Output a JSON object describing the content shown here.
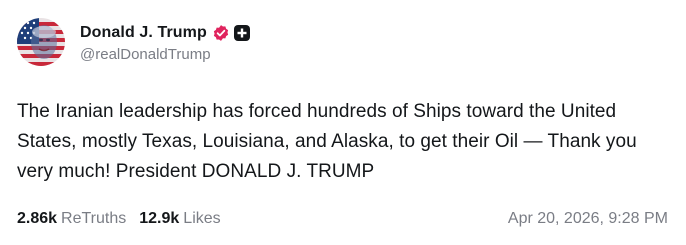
{
  "author": {
    "display_name": "Donald J. Trump",
    "handle": "@realDonaldTrump",
    "avatar_icon": "flag-portrait-avatar",
    "verified_icon": "verified-badge-icon",
    "plus_icon": "plus-badge-icon"
  },
  "post": {
    "text": "The Iranian leadership has forced hundreds of Ships toward the United States, mostly Texas, Louisiana, and Alaska, to get their Oil — Thank you very much! President DONALD J. TRUMP"
  },
  "stats": {
    "retruths_count": "2.86k",
    "retruths_label": "ReTruths",
    "likes_count": "12.9k",
    "likes_label": "Likes"
  },
  "timestamp": "Apr 20, 2026, 9:28 PM",
  "colors": {
    "text_primary": "#14171a",
    "text_secondary": "#7a7d85",
    "verified": "#e0245e",
    "badge_dark": "#14171a"
  }
}
